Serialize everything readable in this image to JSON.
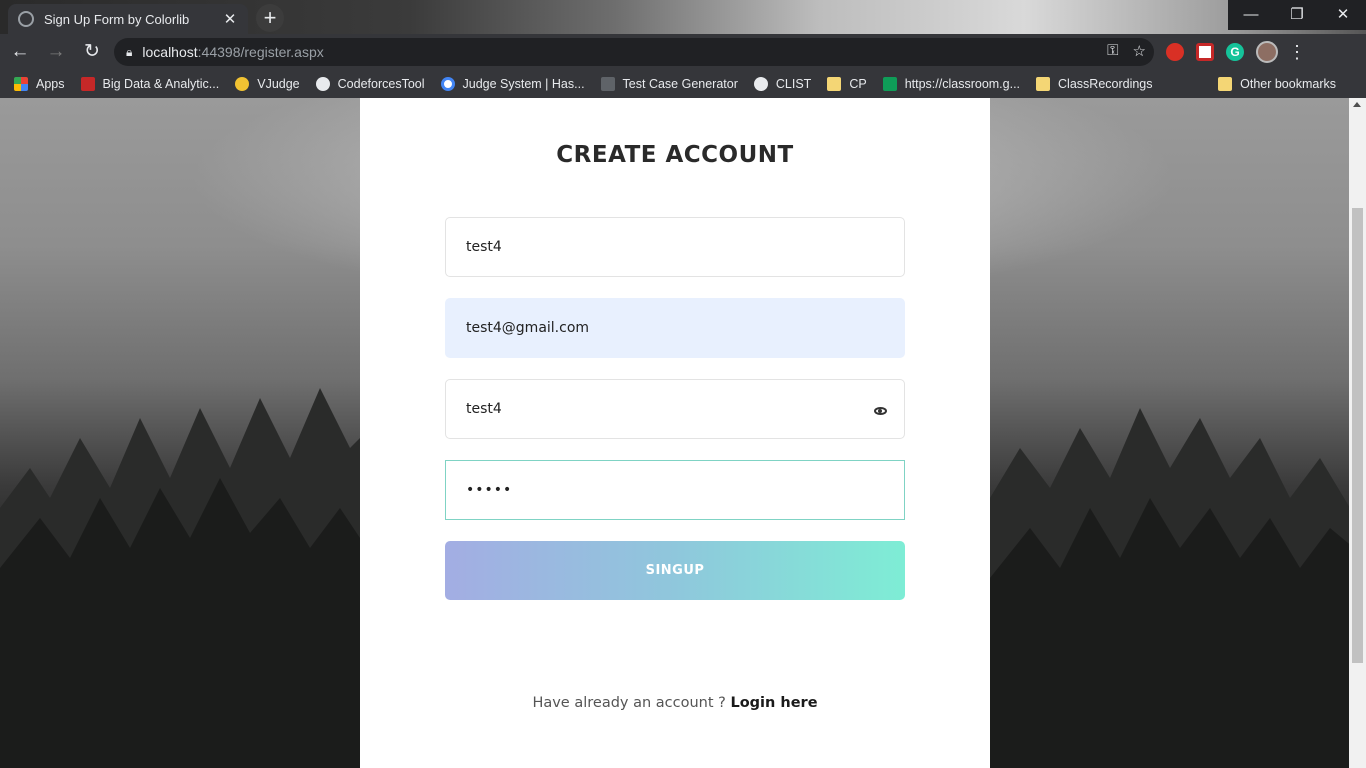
{
  "browser": {
    "tab_title": "Sign Up Form by Colorlib",
    "tab_close": "✕",
    "new_tab": "+",
    "window_controls": {
      "minimize": "—",
      "restore": "❐",
      "close": "✕"
    },
    "nav": {
      "back": "←",
      "forward": "→",
      "reload": "↻"
    },
    "url_host": "localhost",
    "url_rest": ":44398/register.aspx",
    "omnibox_icons": {
      "key": "⚿",
      "star": "☆"
    },
    "extension_green_label": "G",
    "menu": "⋮",
    "bookmarks": [
      {
        "label": "Apps",
        "icon": "apps-grid-icon"
      },
      {
        "label": "Big Data & Analytic...",
        "icon": "red-bookmark-icon"
      },
      {
        "label": "VJudge",
        "icon": "vjudge-icon"
      },
      {
        "label": "CodeforcesTool",
        "icon": "globe-icon"
      },
      {
        "label": "Judge System | Has...",
        "icon": "google-icon"
      },
      {
        "label": "Test Case Generator",
        "icon": "generator-icon"
      },
      {
        "label": "CLIST",
        "icon": "globe-icon"
      },
      {
        "label": "CP",
        "icon": "folder-icon"
      },
      {
        "label": "https://classroom.g...",
        "icon": "classroom-icon"
      },
      {
        "label": "ClassRecordings",
        "icon": "folder-icon"
      }
    ],
    "other_bookmarks": "Other bookmarks"
  },
  "form": {
    "title": "CREATE ACCOUNT",
    "name_value": "test4",
    "email_value": "test4@gmail.com",
    "password_value": "test4",
    "repeat_password_value": "•••••",
    "submit_label": "SINGUP",
    "login_prompt": "Have already an account ?",
    "login_link": "Login here"
  }
}
